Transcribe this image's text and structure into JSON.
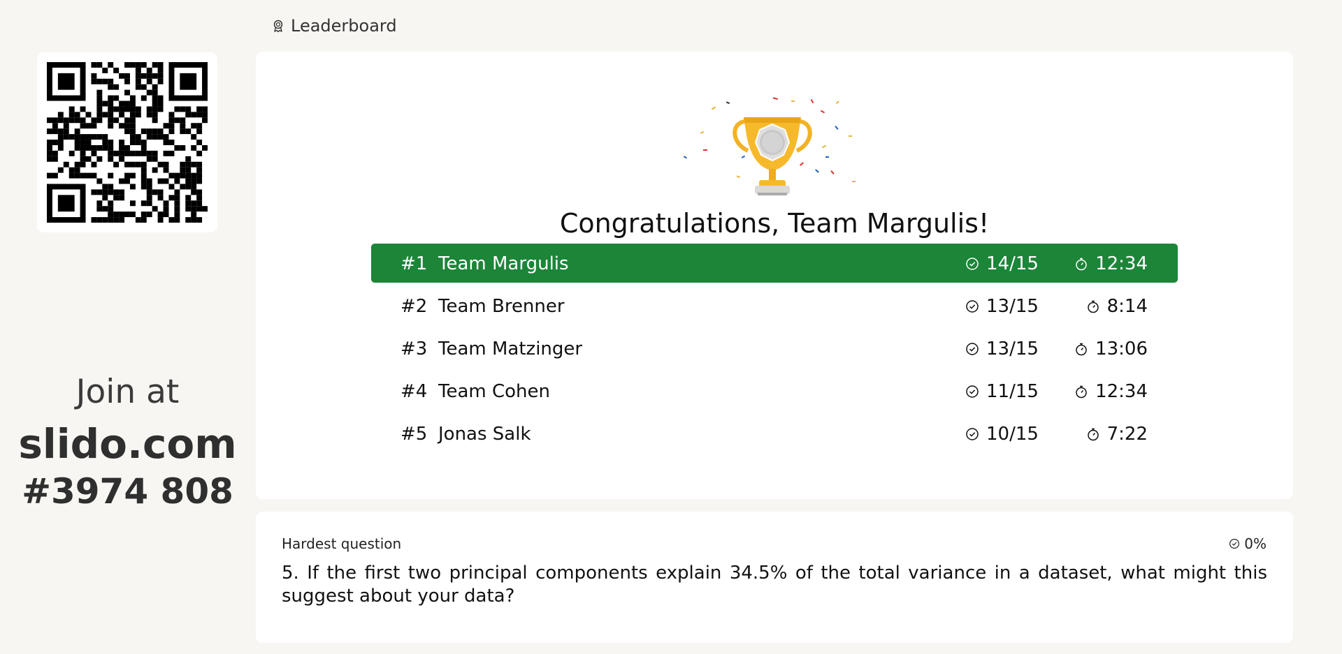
{
  "header": {
    "title": "Leaderboard",
    "icon": "award-icon"
  },
  "join": {
    "line1": "Join at",
    "domain": "slido.com",
    "code": "#3974 808"
  },
  "congrats": "Congratulations, Team Margulis!",
  "leaderboard": [
    {
      "rank": "#1",
      "name": "Team Margulis",
      "score": "14/15",
      "time": "12:34",
      "highlight": true
    },
    {
      "rank": "#2",
      "name": "Team Brenner",
      "score": "13/15",
      "time": "8:14"
    },
    {
      "rank": "#3",
      "name": "Team Matzinger",
      "score": "13/15",
      "time": "13:06"
    },
    {
      "rank": "#4",
      "name": "Team Cohen",
      "score": "11/15",
      "time": "12:34"
    },
    {
      "rank": "#5",
      "name": "Jonas Salk",
      "score": "10/15",
      "time": "7:22"
    }
  ],
  "hardest": {
    "title": "Hardest question",
    "percent": "0%",
    "question": "5. If the first two principal components explain 34.5% of the total variance in a dataset, what might this suggest about your data?"
  },
  "colors": {
    "highlight": "#1c8538",
    "background": "#f8f6f2"
  }
}
